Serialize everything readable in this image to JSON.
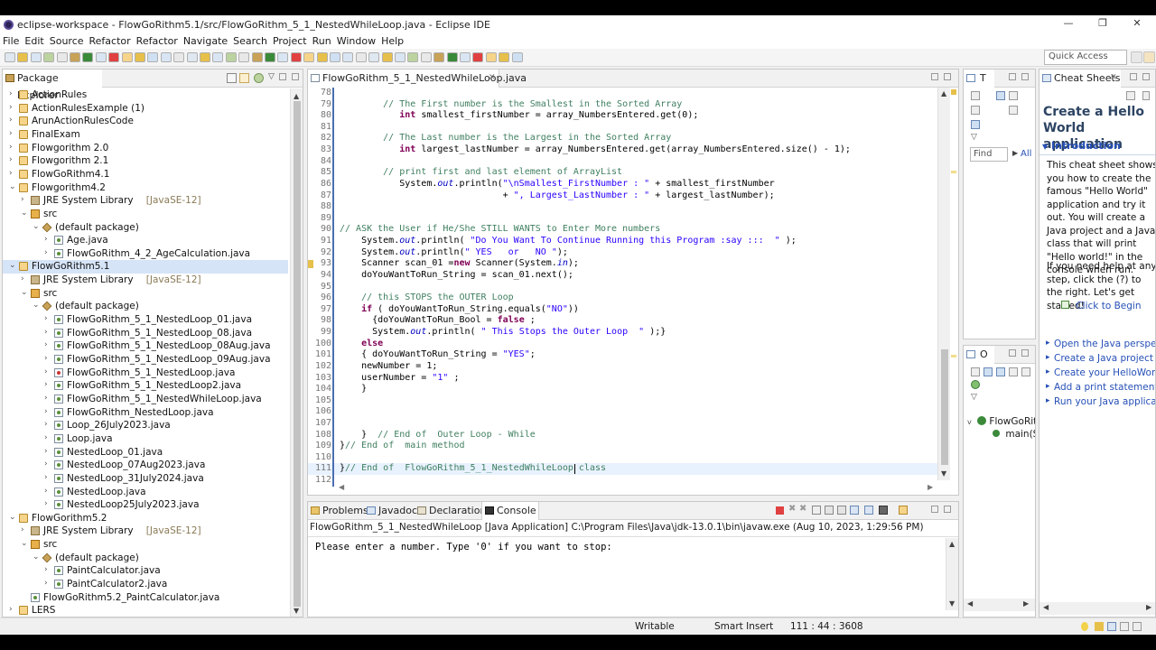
{
  "window": {
    "title": "eclipse-workspace - FlowGoRithm5.1/src/FlowGoRithm_5_1_NestedWhileLoop.java - Eclipse IDE",
    "minimize": "—",
    "maximize": "❐",
    "close": "✕"
  },
  "menu": [
    "File",
    "Edit",
    "Source",
    "Refactor",
    "Refactor",
    "Navigate",
    "Search",
    "Project",
    "Run",
    "Window",
    "Help"
  ],
  "toolbar": {
    "quick_access_placeholder": "Quick Access"
  },
  "package_explorer": {
    "tab_label": "Package Explorer",
    "tree": [
      {
        "indent": 0,
        "twisty": ">",
        "icon": "proj",
        "label": "ActionRules"
      },
      {
        "indent": 0,
        "twisty": ">",
        "icon": "proj",
        "label": "ActionRulesExample (1)"
      },
      {
        "indent": 0,
        "twisty": ">",
        "icon": "proj",
        "label": "ArunActionRulesCode"
      },
      {
        "indent": 0,
        "twisty": ">",
        "icon": "proj",
        "label": "FinalExam"
      },
      {
        "indent": 0,
        "twisty": ">",
        "icon": "proj",
        "label": "Flowgorithm 2.0"
      },
      {
        "indent": 0,
        "twisty": ">",
        "icon": "proj",
        "label": "Flowgorithm 2.1"
      },
      {
        "indent": 0,
        "twisty": ">",
        "icon": "proj",
        "label": "FlowGoRithm4.1"
      },
      {
        "indent": 0,
        "twisty": "v",
        "icon": "proj",
        "label": "Flowgorithm4.2"
      },
      {
        "indent": 1,
        "twisty": ">",
        "icon": "lib",
        "label": "JRE System Library",
        "decor": "[JavaSE-12]"
      },
      {
        "indent": 1,
        "twisty": "v",
        "icon": "src",
        "label": "src"
      },
      {
        "indent": 2,
        "twisty": "v",
        "icon": "pkg",
        "label": "(default package)"
      },
      {
        "indent": 3,
        "twisty": ">",
        "icon": "java",
        "label": "Age.java"
      },
      {
        "indent": 3,
        "twisty": ">",
        "icon": "java",
        "label": "FlowGoRithm_4_2_AgeCalculation.java"
      },
      {
        "indent": 0,
        "twisty": "v",
        "icon": "proj",
        "label": "FlowGoRithm5.1",
        "selected": true
      },
      {
        "indent": 1,
        "twisty": ">",
        "icon": "lib",
        "label": "JRE System Library",
        "decor": "[JavaSE-12]"
      },
      {
        "indent": 1,
        "twisty": "v",
        "icon": "src",
        "label": "src"
      },
      {
        "indent": 2,
        "twisty": "v",
        "icon": "pkg",
        "label": "(default package)"
      },
      {
        "indent": 3,
        "twisty": ">",
        "icon": "java",
        "label": "FlowGoRithm_5_1_NestedLoop_01.java"
      },
      {
        "indent": 3,
        "twisty": ">",
        "icon": "java",
        "label": "FlowGoRithm_5_1_NestedLoop_08.java"
      },
      {
        "indent": 3,
        "twisty": ">",
        "icon": "java",
        "label": "FlowGoRithm_5_1_NestedLoop_08Aug.java"
      },
      {
        "indent": 3,
        "twisty": ">",
        "icon": "java",
        "label": "FlowGoRithm_5_1_NestedLoop_09Aug.java"
      },
      {
        "indent": 3,
        "twisty": ">",
        "icon": "javaerr",
        "label": "FlowGoRithm_5_1_NestedLoop.java"
      },
      {
        "indent": 3,
        "twisty": ">",
        "icon": "java",
        "label": "FlowGoRithm_5_1_NestedLoop2.java"
      },
      {
        "indent": 3,
        "twisty": ">",
        "icon": "java",
        "label": "FlowGoRithm_5_1_NestedWhileLoop.java"
      },
      {
        "indent": 3,
        "twisty": ">",
        "icon": "java",
        "label": "FlowGoRithm_NestedLoop.java"
      },
      {
        "indent": 3,
        "twisty": ">",
        "icon": "java",
        "label": "Loop_26July2023.java"
      },
      {
        "indent": 3,
        "twisty": ">",
        "icon": "java",
        "label": "Loop.java"
      },
      {
        "indent": 3,
        "twisty": ">",
        "icon": "java",
        "label": "NestedLoop_01.java"
      },
      {
        "indent": 3,
        "twisty": ">",
        "icon": "java",
        "label": "NestedLoop_07Aug2023.java"
      },
      {
        "indent": 3,
        "twisty": ">",
        "icon": "java",
        "label": "NestedLoop_31July2024.java"
      },
      {
        "indent": 3,
        "twisty": ">",
        "icon": "java",
        "label": "NestedLoop.java"
      },
      {
        "indent": 3,
        "twisty": ">",
        "icon": "java",
        "label": "NestedLoop25July2023.java"
      },
      {
        "indent": 0,
        "twisty": "v",
        "icon": "proj",
        "label": "FlowGorithm5.2"
      },
      {
        "indent": 1,
        "twisty": ">",
        "icon": "lib",
        "label": "JRE System Library",
        "decor": "[JavaSE-12]"
      },
      {
        "indent": 1,
        "twisty": "v",
        "icon": "src",
        "label": "src"
      },
      {
        "indent": 2,
        "twisty": "v",
        "icon": "pkg",
        "label": "(default package)"
      },
      {
        "indent": 3,
        "twisty": ">",
        "icon": "java",
        "label": "PaintCalculator.java"
      },
      {
        "indent": 3,
        "twisty": ">",
        "icon": "java",
        "label": "PaintCalculator2.java"
      },
      {
        "indent": 1,
        "twisty": "",
        "icon": "java",
        "label": "FlowGoRithm5.2_PaintCalculator.java"
      },
      {
        "indent": 0,
        "twisty": ">",
        "icon": "proj",
        "label": "LERS"
      }
    ]
  },
  "editor": {
    "tab_label": "FlowGoRithm_5_1_NestedWhileLoop.java",
    "lines": [
      {
        "n": "78",
        "segs": []
      },
      {
        "n": "79",
        "segs": [
          [
            "com",
            "        // The First number is the Smallest in the Sorted Array"
          ]
        ]
      },
      {
        "n": "80",
        "segs": [
          [
            "kw",
            "           int"
          ],
          [
            "",
            " smallest_firstNumber = array_NumbersEntered.get(0);"
          ]
        ]
      },
      {
        "n": "81",
        "segs": []
      },
      {
        "n": "82",
        "segs": [
          [
            "com",
            "        // The Last number is the Largest in the Sorted Array"
          ]
        ]
      },
      {
        "n": "83",
        "segs": [
          [
            "kw",
            "           int"
          ],
          [
            "",
            " largest_lastNumber = array_NumbersEntered.get(array_NumbersEntered.size() - 1);"
          ]
        ]
      },
      {
        "n": "84",
        "segs": []
      },
      {
        "n": "85",
        "segs": [
          [
            "com",
            "        // print first and last element of ArrayList"
          ]
        ]
      },
      {
        "n": "86",
        "segs": [
          [
            "",
            "           System."
          ],
          [
            "fld",
            "out"
          ],
          [
            "",
            ".println("
          ],
          [
            "str",
            "\"\\nSmallest_FirstNumber : \""
          ],
          [
            "",
            " + smallest_firstNumber"
          ]
        ]
      },
      {
        "n": "87",
        "segs": [
          [
            "",
            "                              + "
          ],
          [
            "str",
            "\", Largest_LastNumber : \""
          ],
          [
            "",
            " + largest_lastNumber);"
          ]
        ]
      },
      {
        "n": "88",
        "segs": []
      },
      {
        "n": "89",
        "segs": []
      },
      {
        "n": "90",
        "segs": [
          [
            "com",
            "// ASK the User if He/She STILL WANTS to Enter More numbers"
          ]
        ]
      },
      {
        "n": "91",
        "segs": [
          [
            "",
            "    System."
          ],
          [
            "fld",
            "out"
          ],
          [
            "",
            ".println( "
          ],
          [
            "str",
            "\"Do You Want To Continue Running this Program :say :::  \""
          ],
          [
            "",
            " );"
          ]
        ]
      },
      {
        "n": "92",
        "segs": [
          [
            "",
            "    System."
          ],
          [
            "fld",
            "out"
          ],
          [
            "",
            ".println("
          ],
          [
            "str",
            "\" YES   or   NO \""
          ],
          [
            "",
            ");"
          ]
        ]
      },
      {
        "n": "93",
        "segs": [
          [
            "",
            "    Scanner scan_01 ="
          ],
          [
            "kw",
            "new"
          ],
          [
            "",
            " Scanner(System."
          ],
          [
            "fld",
            "in"
          ],
          [
            "",
            ");"
          ]
        ]
      },
      {
        "n": "94",
        "segs": [
          [
            "",
            "    doYouWantToRun_String = scan_01.next();"
          ]
        ]
      },
      {
        "n": "95",
        "segs": []
      },
      {
        "n": "96",
        "segs": [
          [
            "com",
            "    // this STOPS the OUTER Loop"
          ]
        ]
      },
      {
        "n": "97",
        "segs": [
          [
            "kw",
            "    if"
          ],
          [
            "",
            " ( doYouWantToRun_String.equals("
          ],
          [
            "str",
            "\"NO\""
          ],
          [
            "",
            "))"
          ]
        ]
      },
      {
        "n": "98",
        "segs": [
          [
            "",
            "      {doYouWantToRun_Bool = "
          ],
          [
            "kw",
            "false"
          ],
          [
            "",
            " ;"
          ]
        ]
      },
      {
        "n": "99",
        "segs": [
          [
            "",
            "      System."
          ],
          [
            "fld",
            "out"
          ],
          [
            "",
            ".println( "
          ],
          [
            "str",
            "\" This Stops the Outer Loop  \""
          ],
          [
            "",
            " );}"
          ]
        ]
      },
      {
        "n": "100",
        "segs": [
          [
            "kw",
            "    else"
          ]
        ]
      },
      {
        "n": "101",
        "segs": [
          [
            "",
            "    { doYouWantToRun_String = "
          ],
          [
            "str",
            "\"YES\""
          ],
          [
            "",
            ";"
          ]
        ]
      },
      {
        "n": "102",
        "segs": [
          [
            "",
            "    newNumber = 1;"
          ]
        ]
      },
      {
        "n": "103",
        "segs": [
          [
            "",
            "    userNumber = "
          ],
          [
            "str",
            "\"1\""
          ],
          [
            "",
            " ;"
          ]
        ]
      },
      {
        "n": "104",
        "segs": [
          [
            "",
            "    }"
          ]
        ]
      },
      {
        "n": "105",
        "segs": []
      },
      {
        "n": "106",
        "segs": []
      },
      {
        "n": "107",
        "segs": []
      },
      {
        "n": "108",
        "segs": [
          [
            "",
            "    }  "
          ],
          [
            "com",
            "// End of  Outer Loop - While"
          ]
        ]
      },
      {
        "n": "109",
        "segs": [
          [
            "",
            "}"
          ],
          [
            "com",
            "// End of  main method"
          ]
        ]
      },
      {
        "n": "110",
        "segs": []
      },
      {
        "n": "111",
        "segs": [
          [
            "",
            "}"
          ],
          [
            "com",
            "// End of  FlowGoRithm_5_1_NestedWhileLoop class"
          ]
        ],
        "current": true
      },
      {
        "n": "112",
        "segs": []
      }
    ]
  },
  "bottom_panel": {
    "tabs": [
      "Problems",
      "Javadoc",
      "Declaration",
      "Console"
    ],
    "launch_info": "FlowGoRithm_5_1_NestedWhileLoop [Java Application] C:\\Program Files\\Java\\jdk-13.0.1\\bin\\javaw.exe (Aug 10, 2023, 1:29:56 PM)",
    "output": "Please enter a number. Type '0' if you want to stop:"
  },
  "task_panel": {
    "tab_label": "T",
    "find_placeholder": "Find",
    "all_label": "All"
  },
  "outline_panel": {
    "tab_label": "O",
    "class_name": "FlowGoRit",
    "method_name": "main(St"
  },
  "cheat_sheet": {
    "tab_label": "Cheat Sheets",
    "title": "Create a Hello World application",
    "section": "Introduction",
    "intro": "This cheat sheet shows you how to create the famous \"Hello World\" application and try it out. You will create a Java project and a Java class that will print \"Hello world!\" in the console when run.",
    "help": "If you need help at any step, click the (?) to the right. Let's get started!",
    "begin": "Click to Begin",
    "steps": [
      "Open the Java perspective",
      "Create a Java project",
      "Create your HelloWorld class",
      "Add a print statement",
      "Run your Java application"
    ]
  },
  "status_bar": {
    "mode": "Writable",
    "insert": "Smart Insert",
    "position": "111 : 44 : 3608"
  },
  "colors": {
    "keyword": "#7f0055",
    "string": "#2a00ff",
    "comment": "#3f7f5f",
    "field": "#0000c0",
    "link": "#2650b6",
    "selection": "#d6e4f7"
  }
}
